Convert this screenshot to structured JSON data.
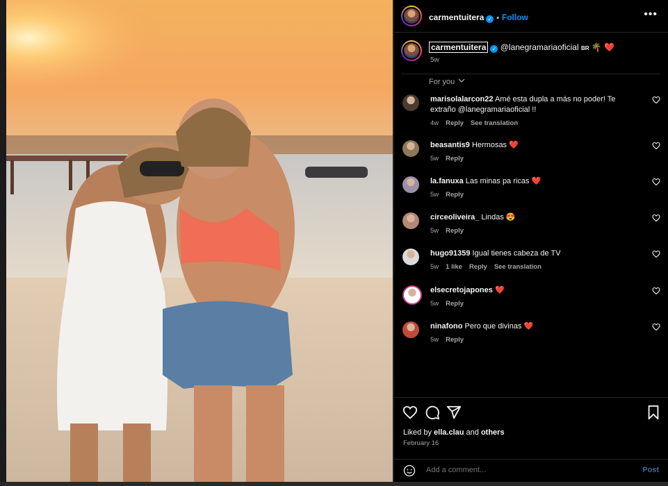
{
  "post": {
    "username": "carmentuitera",
    "follow_label": "Follow",
    "dot": "•",
    "more_label": "•••",
    "caption": {
      "username": "carmentuitera",
      "mention": "@lanegramariaoficial",
      "suffix": "BR",
      "emoji_tree": "🌴",
      "emoji_heart": "❤️",
      "age": "5w"
    },
    "sort_label": "For you",
    "chevron": "⌄"
  },
  "comments": [
    {
      "user": "marisolalarcon22",
      "text": "Amé esta dupla a más no poder! Te extraño @lanegramariaoficial !!",
      "age": "4w",
      "likes": "",
      "reply": "Reply",
      "translate": "See translation",
      "avatar": "#4a3b33"
    },
    {
      "user": "beasantis9",
      "text": "Hermosas ❤️",
      "age": "5w",
      "likes": "",
      "reply": "Reply",
      "translate": "",
      "avatar": "#8a7a5a"
    },
    {
      "user": "la.fanuxa",
      "text": "Las minas pa ricas ❤️",
      "age": "5w",
      "likes": "",
      "reply": "Reply",
      "translate": "",
      "avatar": "#9c8fa8"
    },
    {
      "user": "circeoliveira_",
      "text": "Lindas 😍",
      "age": "5w",
      "likes": "",
      "reply": "Reply",
      "translate": "",
      "avatar": "#b58876"
    },
    {
      "user": "hugo91359",
      "text": "Igual tienes cabeza de TV",
      "age": "5w",
      "likes": "1 like",
      "reply": "Reply",
      "translate": "See translation",
      "avatar": "#dbdbdb"
    },
    {
      "user": "elsecretojapones",
      "text": "❤️",
      "age": "5w",
      "likes": "",
      "reply": "Reply",
      "translate": "",
      "avatar": "#ffffff"
    },
    {
      "user": "ninafono",
      "text": "Pero que divinas ❤️",
      "age": "5w",
      "likes": "",
      "reply": "Reply",
      "translate": "",
      "avatar": "#c24a3a"
    }
  ],
  "footer": {
    "liked_prefix": "Liked by",
    "liked_user": "ella.clau",
    "liked_and": "and",
    "liked_others": "others",
    "date": "February 16",
    "add_comment_placeholder": "Add a comment...",
    "post_label": "Post"
  },
  "icons": {
    "like": "heart-icon",
    "comment": "comment-icon",
    "share": "share-icon",
    "save": "bookmark-icon",
    "emoji": "emoji-icon",
    "options": "more-options-icon",
    "verified": "verified-badge-icon"
  },
  "colors": {
    "accent": "#0095f6",
    "heart": "#ff3040",
    "background": "#000000",
    "secondary_text": "#a8a8a8"
  }
}
